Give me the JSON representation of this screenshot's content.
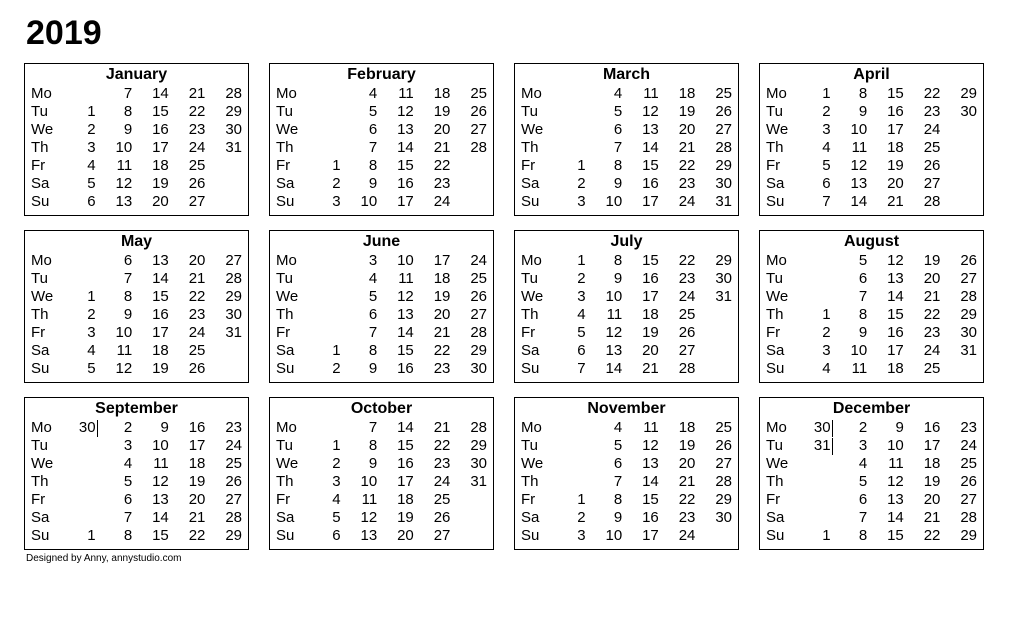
{
  "year": "2019",
  "footer": "Designed by Anny,  annystudio.com",
  "weekdays": [
    "Mo",
    "Tu",
    "We",
    "Th",
    "Fr",
    "Sa",
    "Su"
  ],
  "months": [
    {
      "name": "January",
      "cells": [
        [
          "",
          "7",
          "14",
          "21",
          "28"
        ],
        [
          "1",
          "8",
          "15",
          "22",
          "29"
        ],
        [
          "2",
          "9",
          "16",
          "23",
          "30"
        ],
        [
          "3",
          "10",
          "17",
          "24",
          "31"
        ],
        [
          "4",
          "11",
          "18",
          "25",
          ""
        ],
        [
          "5",
          "12",
          "19",
          "26",
          ""
        ],
        [
          "6",
          "13",
          "20",
          "27",
          ""
        ]
      ],
      "prev_month_cells": []
    },
    {
      "name": "February",
      "cells": [
        [
          "",
          "4",
          "11",
          "18",
          "25"
        ],
        [
          "",
          "5",
          "12",
          "19",
          "26"
        ],
        [
          "",
          "6",
          "13",
          "20",
          "27"
        ],
        [
          "",
          "7",
          "14",
          "21",
          "28"
        ],
        [
          "1",
          "8",
          "15",
          "22",
          ""
        ],
        [
          "2",
          "9",
          "16",
          "23",
          ""
        ],
        [
          "3",
          "10",
          "17",
          "24",
          ""
        ]
      ],
      "prev_month_cells": []
    },
    {
      "name": "March",
      "cells": [
        [
          "",
          "4",
          "11",
          "18",
          "25"
        ],
        [
          "",
          "5",
          "12",
          "19",
          "26"
        ],
        [
          "",
          "6",
          "13",
          "20",
          "27"
        ],
        [
          "",
          "7",
          "14",
          "21",
          "28"
        ],
        [
          "1",
          "8",
          "15",
          "22",
          "29"
        ],
        [
          "2",
          "9",
          "16",
          "23",
          "30"
        ],
        [
          "3",
          "10",
          "17",
          "24",
          "31"
        ]
      ],
      "prev_month_cells": []
    },
    {
      "name": "April",
      "cells": [
        [
          "1",
          "8",
          "15",
          "22",
          "29"
        ],
        [
          "2",
          "9",
          "16",
          "23",
          "30"
        ],
        [
          "3",
          "10",
          "17",
          "24",
          ""
        ],
        [
          "4",
          "11",
          "18",
          "25",
          ""
        ],
        [
          "5",
          "12",
          "19",
          "26",
          ""
        ],
        [
          "6",
          "13",
          "20",
          "27",
          ""
        ],
        [
          "7",
          "14",
          "21",
          "28",
          ""
        ]
      ],
      "prev_month_cells": []
    },
    {
      "name": "May",
      "cells": [
        [
          "",
          "6",
          "13",
          "20",
          "27"
        ],
        [
          "",
          "7",
          "14",
          "21",
          "28"
        ],
        [
          "1",
          "8",
          "15",
          "22",
          "29"
        ],
        [
          "2",
          "9",
          "16",
          "23",
          "30"
        ],
        [
          "3",
          "10",
          "17",
          "24",
          "31"
        ],
        [
          "4",
          "11",
          "18",
          "25",
          ""
        ],
        [
          "5",
          "12",
          "19",
          "26",
          ""
        ]
      ],
      "prev_month_cells": []
    },
    {
      "name": "June",
      "cells": [
        [
          "",
          "3",
          "10",
          "17",
          "24"
        ],
        [
          "",
          "4",
          "11",
          "18",
          "25"
        ],
        [
          "",
          "5",
          "12",
          "19",
          "26"
        ],
        [
          "",
          "6",
          "13",
          "20",
          "27"
        ],
        [
          "",
          "7",
          "14",
          "21",
          "28"
        ],
        [
          "1",
          "8",
          "15",
          "22",
          "29"
        ],
        [
          "2",
          "9",
          "16",
          "23",
          "30"
        ]
      ],
      "prev_month_cells": []
    },
    {
      "name": "July",
      "cells": [
        [
          "1",
          "8",
          "15",
          "22",
          "29"
        ],
        [
          "2",
          "9",
          "16",
          "23",
          "30"
        ],
        [
          "3",
          "10",
          "17",
          "24",
          "31"
        ],
        [
          "4",
          "11",
          "18",
          "25",
          ""
        ],
        [
          "5",
          "12",
          "19",
          "26",
          ""
        ],
        [
          "6",
          "13",
          "20",
          "27",
          ""
        ],
        [
          "7",
          "14",
          "21",
          "28",
          ""
        ]
      ],
      "prev_month_cells": []
    },
    {
      "name": "August",
      "cells": [
        [
          "",
          "5",
          "12",
          "19",
          "26"
        ],
        [
          "",
          "6",
          "13",
          "20",
          "27"
        ],
        [
          "",
          "7",
          "14",
          "21",
          "28"
        ],
        [
          "1",
          "8",
          "15",
          "22",
          "29"
        ],
        [
          "2",
          "9",
          "16",
          "23",
          "30"
        ],
        [
          "3",
          "10",
          "17",
          "24",
          "31"
        ],
        [
          "4",
          "11",
          "18",
          "25",
          ""
        ]
      ],
      "prev_month_cells": []
    },
    {
      "name": "September",
      "cells": [
        [
          "30",
          "2",
          "9",
          "16",
          "23"
        ],
        [
          "",
          "3",
          "10",
          "17",
          "24"
        ],
        [
          "",
          "4",
          "11",
          "18",
          "25"
        ],
        [
          "",
          "5",
          "12",
          "19",
          "26"
        ],
        [
          "",
          "6",
          "13",
          "20",
          "27"
        ],
        [
          "",
          "7",
          "14",
          "21",
          "28"
        ],
        [
          "1",
          "8",
          "15",
          "22",
          "29"
        ]
      ],
      "prev_month_cells": [
        "0,0"
      ]
    },
    {
      "name": "October",
      "cells": [
        [
          "",
          "7",
          "14",
          "21",
          "28"
        ],
        [
          "1",
          "8",
          "15",
          "22",
          "29"
        ],
        [
          "2",
          "9",
          "16",
          "23",
          "30"
        ],
        [
          "3",
          "10",
          "17",
          "24",
          "31"
        ],
        [
          "4",
          "11",
          "18",
          "25",
          ""
        ],
        [
          "5",
          "12",
          "19",
          "26",
          ""
        ],
        [
          "6",
          "13",
          "20",
          "27",
          ""
        ]
      ],
      "prev_month_cells": []
    },
    {
      "name": "November",
      "cells": [
        [
          "",
          "4",
          "11",
          "18",
          "25"
        ],
        [
          "",
          "5",
          "12",
          "19",
          "26"
        ],
        [
          "",
          "6",
          "13",
          "20",
          "27"
        ],
        [
          "",
          "7",
          "14",
          "21",
          "28"
        ],
        [
          "1",
          "8",
          "15",
          "22",
          "29"
        ],
        [
          "2",
          "9",
          "16",
          "23",
          "30"
        ],
        [
          "3",
          "10",
          "17",
          "24",
          ""
        ]
      ],
      "prev_month_cells": []
    },
    {
      "name": "December",
      "cells": [
        [
          "30",
          "2",
          "9",
          "16",
          "23"
        ],
        [
          "31",
          "3",
          "10",
          "17",
          "24"
        ],
        [
          "",
          "4",
          "11",
          "18",
          "25"
        ],
        [
          "",
          "5",
          "12",
          "19",
          "26"
        ],
        [
          "",
          "6",
          "13",
          "20",
          "27"
        ],
        [
          "",
          "7",
          "14",
          "21",
          "28"
        ],
        [
          "1",
          "8",
          "15",
          "22",
          "29"
        ]
      ],
      "prev_month_cells": [
        "0,0",
        "1,0"
      ]
    }
  ]
}
